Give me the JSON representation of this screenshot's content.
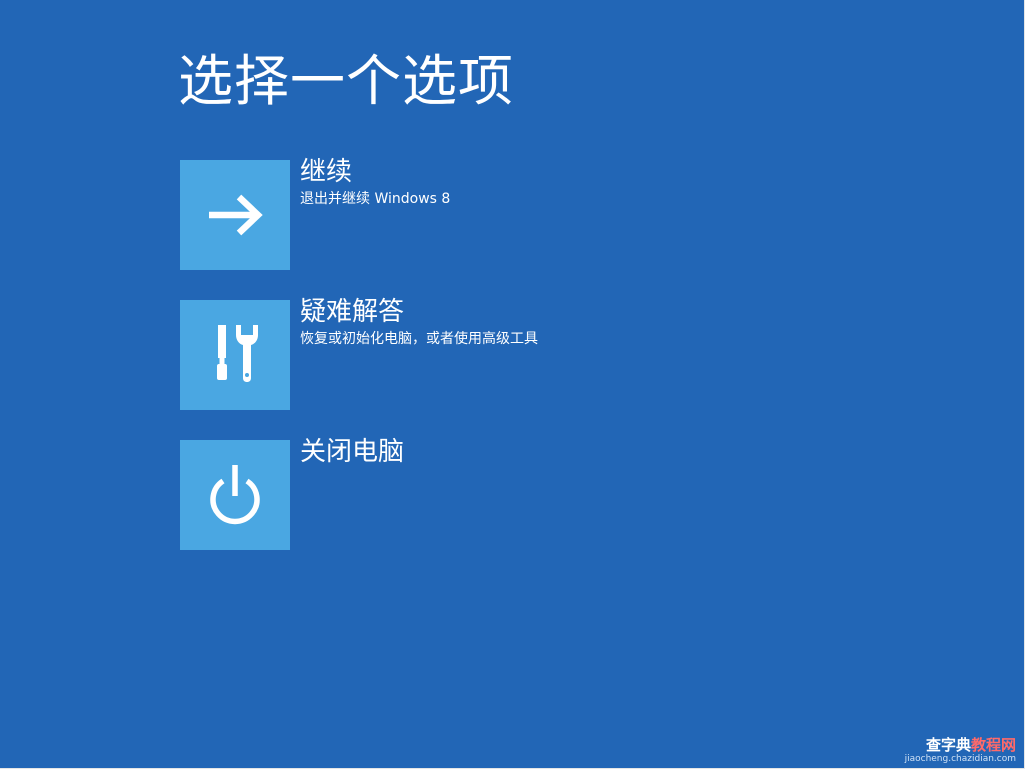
{
  "screen": {
    "title": "选择一个选项",
    "background_color": "#2266b6",
    "tile_color": "#4aa7e2"
  },
  "options": [
    {
      "title": "继续",
      "description": "退出并继续 Windows 8",
      "icon": "arrow-right-icon"
    },
    {
      "title": "疑难解答",
      "description": "恢复或初始化电脑，或者使用高级工具",
      "icon": "tools-icon"
    },
    {
      "title": "关闭电脑",
      "description": "",
      "icon": "power-icon"
    }
  ],
  "watermark": {
    "name_white": "查字典",
    "name_red": "教程网",
    "url": "jiaocheng.chazidian.com"
  }
}
